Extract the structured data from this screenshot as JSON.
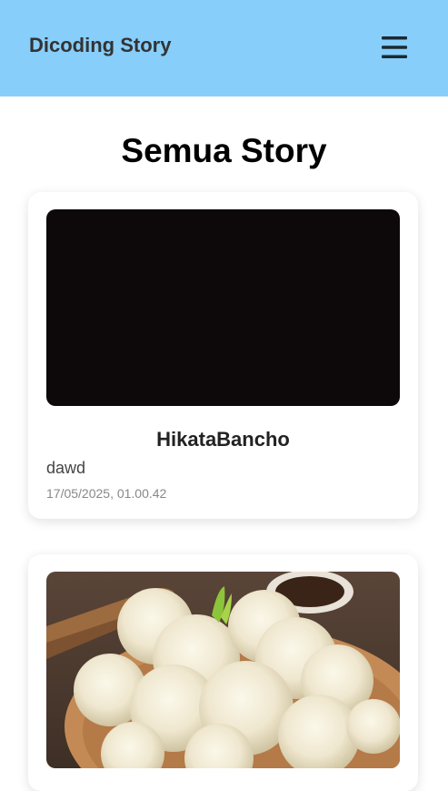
{
  "header": {
    "brand": "Dicoding Story",
    "menu_icon": "hamburger-icon",
    "background_color": "#87cefa"
  },
  "main": {
    "title": "Semua Story"
  },
  "stories": [
    {
      "name": "HikataBancho",
      "description": "dawd",
      "date": "17/05/2025, 01.00.42"
    }
  ]
}
